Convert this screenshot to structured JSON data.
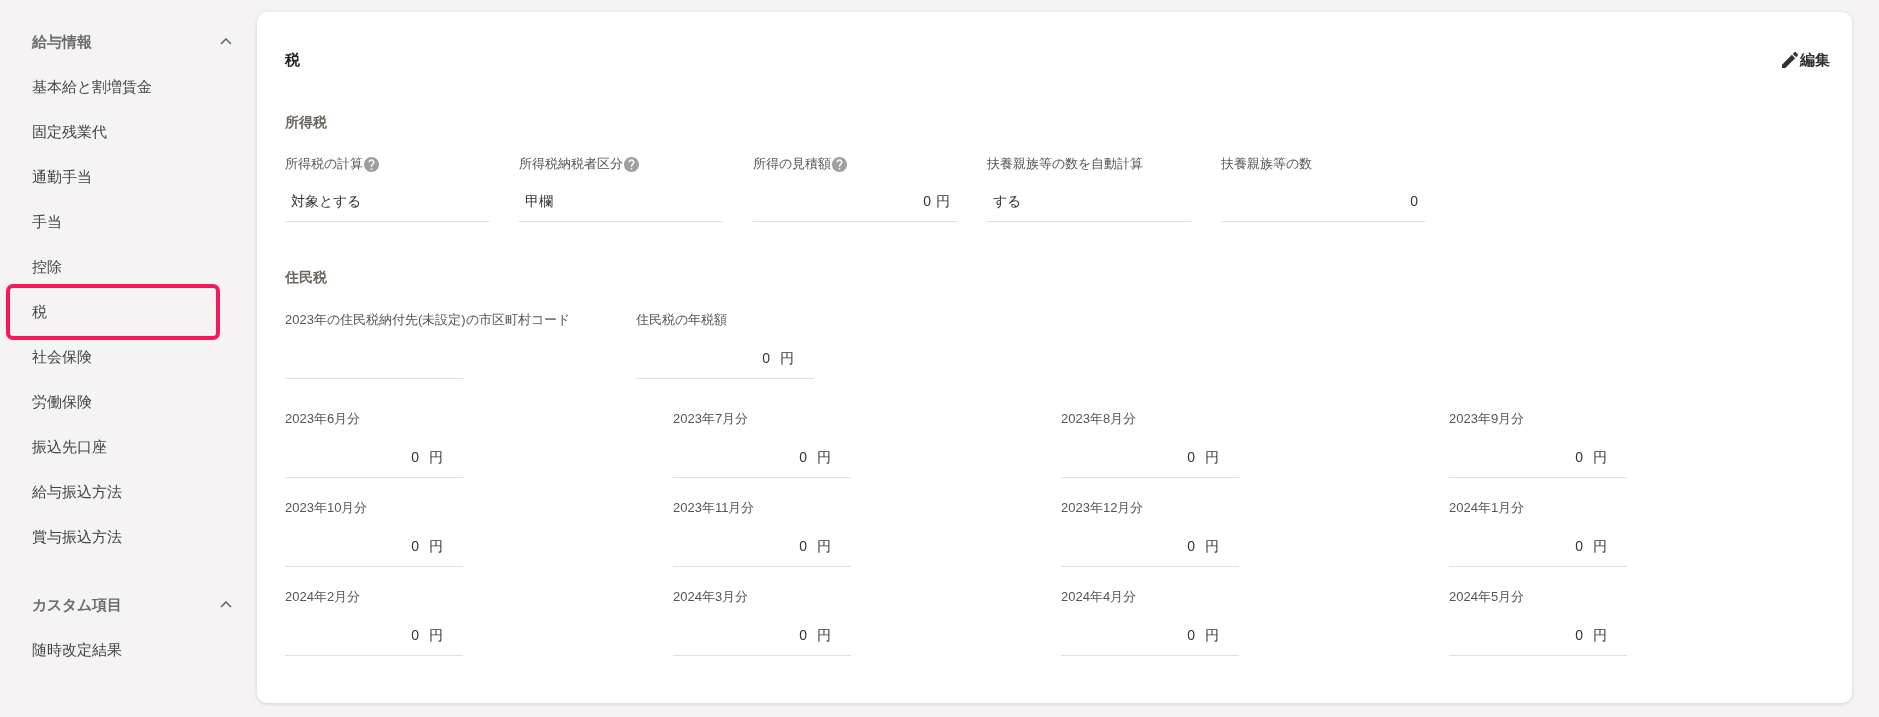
{
  "sidebar": {
    "groups": [
      {
        "title": "給与情報",
        "expanded": true,
        "items": [
          {
            "label": "基本給と割増賃金",
            "selected": false
          },
          {
            "label": "固定残業代",
            "selected": false
          },
          {
            "label": "通勤手当",
            "selected": false
          },
          {
            "label": "手当",
            "selected": false
          },
          {
            "label": "控除",
            "selected": false
          },
          {
            "label": "税",
            "selected": true
          },
          {
            "label": "社会保険",
            "selected": false
          },
          {
            "label": "労働保険",
            "selected": false
          },
          {
            "label": "振込先口座",
            "selected": false
          },
          {
            "label": "給与振込方法",
            "selected": false
          },
          {
            "label": "賞与振込方法",
            "selected": false
          }
        ]
      },
      {
        "title": "カスタム項目",
        "expanded": true,
        "items": [
          {
            "label": "随時改定結果",
            "selected": false
          }
        ]
      }
    ]
  },
  "panel": {
    "title": "税",
    "edit_button": "編集",
    "income_tax": {
      "heading": "所得税",
      "fields": [
        {
          "label": "所得税の計算",
          "help": true,
          "kind": "text",
          "value": "対象とする"
        },
        {
          "label": "所得税納税者区分",
          "help": true,
          "kind": "text",
          "value": "甲欄"
        },
        {
          "label": "所得の見積額",
          "help": true,
          "kind": "amount",
          "value": "0",
          "unit": "円"
        },
        {
          "label": "扶養親族等の数を自動計算",
          "help": false,
          "kind": "text",
          "value": "する"
        },
        {
          "label": "扶養親族等の数",
          "help": false,
          "kind": "number",
          "value": "0"
        }
      ]
    },
    "resident_tax": {
      "heading": "住民税",
      "fields": [
        {
          "label": "2023年の住民税納付先(未設定)の市区町村コード",
          "kind": "text"
        },
        {
          "label": "住民税の年税額",
          "kind": "amount",
          "value": "0",
          "unit": "円"
        }
      ],
      "monthly": [
        {
          "label": "2023年6月分",
          "kind": "amount",
          "value": "0",
          "unit": "円"
        },
        {
          "label": "2023年7月分",
          "kind": "amount",
          "value": "0",
          "unit": "円"
        },
        {
          "label": "2023年8月分",
          "kind": "amount",
          "value": "0",
          "unit": "円"
        },
        {
          "label": "2023年9月分",
          "kind": "amount",
          "value": "0",
          "unit": "円"
        },
        {
          "label": "2023年10月分",
          "kind": "amount",
          "value": "0",
          "unit": "円"
        },
        {
          "label": "2023年11月分",
          "kind": "amount",
          "value": "0",
          "unit": "円"
        },
        {
          "label": "2023年12月分",
          "kind": "amount",
          "value": "0",
          "unit": "円"
        },
        {
          "label": "2024年1月分",
          "kind": "amount",
          "value": "0",
          "unit": "円"
        },
        {
          "label": "2024年2月分",
          "kind": "amount",
          "value": "0",
          "unit": "円"
        },
        {
          "label": "2024年3月分",
          "kind": "amount",
          "value": "0",
          "unit": "円"
        },
        {
          "label": "2024年4月分",
          "kind": "amount",
          "value": "0",
          "unit": "円"
        },
        {
          "label": "2024年5月分",
          "kind": "amount",
          "value": "0",
          "unit": "円"
        }
      ]
    }
  }
}
